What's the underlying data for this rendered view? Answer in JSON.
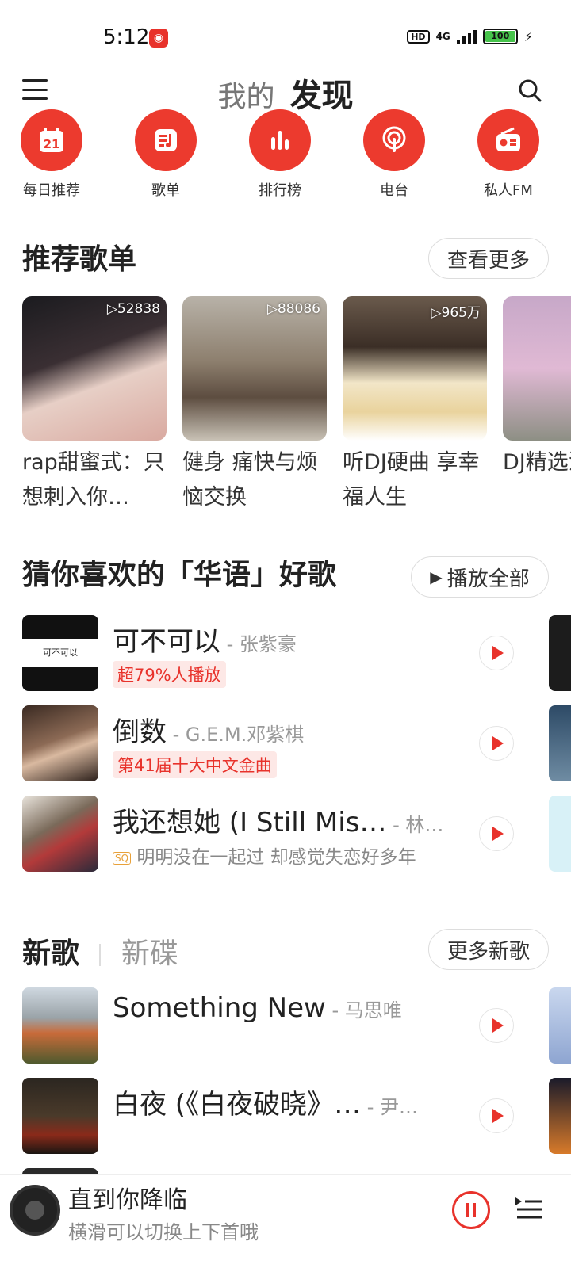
{
  "status": {
    "time": "5:12",
    "network": "4G",
    "hd": "HD",
    "battery": "100"
  },
  "header": {
    "tab_mine": "我的",
    "tab_discover": "发现"
  },
  "categories": [
    {
      "label": "每日推荐",
      "icon": "calendar-icon",
      "day": "21"
    },
    {
      "label": "歌单",
      "icon": "playlist-icon"
    },
    {
      "label": "排行榜",
      "icon": "chart-icon"
    },
    {
      "label": "电台",
      "icon": "podcast-icon"
    },
    {
      "label": "私人FM",
      "icon": "radio-icon"
    }
  ],
  "recommend": {
    "title": "推荐歌单",
    "more": "查看更多",
    "playlists": [
      {
        "count": "▷52838",
        "name": "rap甜蜜式：只想刺入你…"
      },
      {
        "count": "▷88086",
        "name": "健身 痛快与烦恼交换"
      },
      {
        "count": "▷965万",
        "name": "听DJ硬曲 享幸福人生"
      },
      {
        "count": "",
        "name": "DJ精选流行热"
      }
    ]
  },
  "guess": {
    "title": "猜你喜欢的「华语」好歌",
    "play_all": "播放全部",
    "songs": [
      {
        "title": "可不可以",
        "artist": " - 张紫豪",
        "tag": "超79%人播放",
        "thumb_text": "可不可以"
      },
      {
        "title": "倒数",
        "artist": " - G.E.M.邓紫棋",
        "tag": "第41届十大中文金曲"
      },
      {
        "title": "我还想她 (I Still Mis…",
        "artist": " - 林…",
        "sub_badge": "SQ",
        "sub": "明明没在一起过 却感觉失恋好多年"
      }
    ]
  },
  "new": {
    "tab_songs": "新歌",
    "tab_albums": "新碟",
    "more": "更多新歌",
    "songs": [
      {
        "title": "Something New",
        "artist": " - 马思唯"
      },
      {
        "title": "白夜 (《白夜破晓》…",
        "artist": " - 尹…"
      }
    ]
  },
  "player": {
    "title": "直到你降临",
    "hint": "横滑可以切换上下首哦"
  },
  "colors": {
    "accent": "#e8322b",
    "icon_bg": "#ec3a2e"
  }
}
